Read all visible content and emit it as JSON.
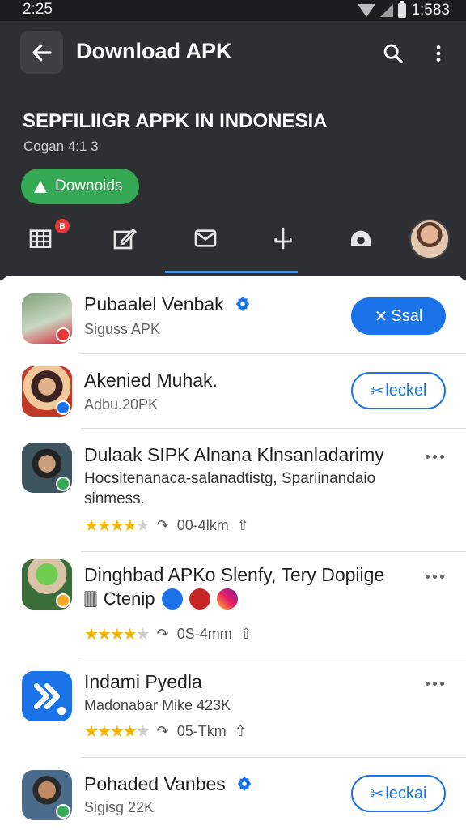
{
  "status_bar": {
    "time": "2:25",
    "right_text": "1:583"
  },
  "app_bar": {
    "title": "Download APK"
  },
  "header": {
    "headline": "SEPFILIIGR APPK IN INDONESIA",
    "subline": "Cogan 4:1 3",
    "download_pill": "Downoids"
  },
  "tabs": {
    "badge": "B",
    "items": [
      "grid-icon",
      "edit-icon",
      "mail-icon",
      "anchor-icon",
      "camera-icon",
      "profile-avatar"
    ],
    "selected_index": 2
  },
  "list": [
    {
      "title": "Pubaalel Venbak",
      "sub": "Siguss APK",
      "verified": true,
      "action": "Ssal",
      "action_style": "filled"
    },
    {
      "title": "Akenied Muhak.",
      "sub": "Adbu.20PK",
      "action": "leckel",
      "action_style": "outline"
    },
    {
      "title": "Dulaak SIPK Alnana Klnsanladarimy",
      "desc1": "Hocsitenanaca-salanadtistg, Spariinandaio",
      "desc2": "sinmess.",
      "rating": 3.5,
      "stat": "00-4lkm"
    },
    {
      "title": "Dinghbad APKo Slenfy, Tery Dopiige",
      "sub2": "Ctenip",
      "rating": 3.5,
      "stat": "0S-4mm"
    },
    {
      "title": "Indami Pyedla",
      "sub": "Madonabar Mike 423K",
      "rating": 3.5,
      "stat": "05-Tkm"
    },
    {
      "title": "Pohaded Vanbes",
      "sub": "Sigisg 22K",
      "verified": true,
      "action": "leckai",
      "action_style": "outline"
    }
  ],
  "colors": {
    "dark_bg": "#2d2f33",
    "accent_blue": "#1a73e8",
    "green": "#34a853",
    "star": "#f5b400"
  }
}
